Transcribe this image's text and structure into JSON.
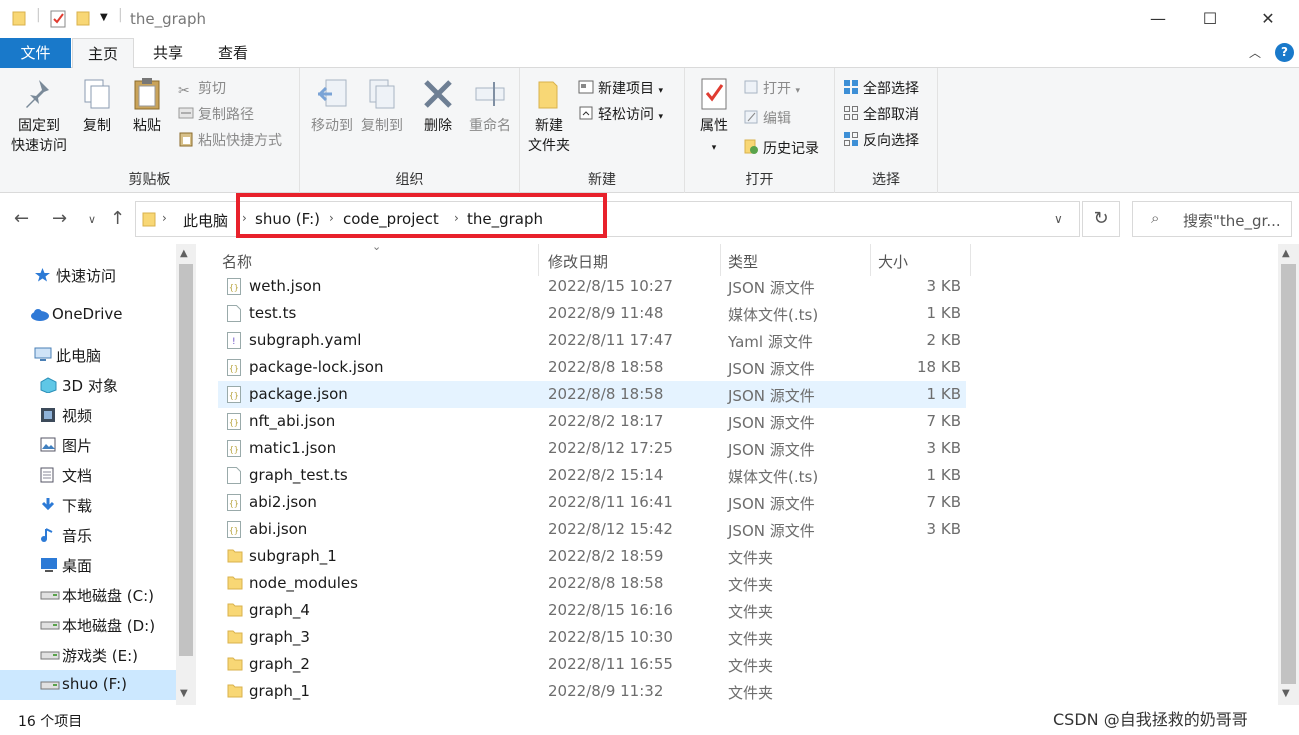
{
  "window": {
    "title": "the_graph",
    "minimize": "—",
    "maximize": "☐",
    "close": "✕"
  },
  "tabs": {
    "file": "文件",
    "home": "主页",
    "share": "共享",
    "view": "查看"
  },
  "ribbon": {
    "clipboard": {
      "label": "剪贴板",
      "pin_line1": "固定到",
      "pin_line2": "快速访问",
      "copy": "复制",
      "paste": "粘贴",
      "cut": "剪切",
      "copy_path": "复制路径",
      "paste_shortcut": "粘贴快捷方式"
    },
    "organize": {
      "label": "组织",
      "move_to": "移动到",
      "copy_to": "复制到",
      "delete": "删除",
      "rename": "重命名"
    },
    "new": {
      "label": "新建",
      "new_folder_line1": "新建",
      "new_folder_line2": "文件夹",
      "new_item": "新建项目",
      "easy_access": "轻松访问"
    },
    "open": {
      "label": "打开",
      "properties": "属性",
      "open": "打开",
      "edit": "编辑",
      "history": "历史记录"
    },
    "select": {
      "label": "选择",
      "select_all": "全部选择",
      "select_none": "全部取消",
      "invert": "反向选择"
    }
  },
  "address": {
    "crumbs": [
      "此电脑",
      "shuo (F:)",
      "code_project",
      "the_graph"
    ],
    "search_placeholder": "搜索\"the_gr..."
  },
  "nav": {
    "items": [
      {
        "label": "快速访问",
        "icon": "star-icon"
      },
      {
        "label": "OneDrive",
        "icon": "cloud-icon"
      },
      {
        "label": "此电脑",
        "icon": "computer-icon"
      },
      {
        "label": "3D 对象",
        "icon": "cube-icon"
      },
      {
        "label": "视频",
        "icon": "film-icon"
      },
      {
        "label": "图片",
        "icon": "picture-icon"
      },
      {
        "label": "文档",
        "icon": "document-icon"
      },
      {
        "label": "下载",
        "icon": "download-icon"
      },
      {
        "label": "音乐",
        "icon": "music-icon"
      },
      {
        "label": "桌面",
        "icon": "desktop-icon"
      },
      {
        "label": "本地磁盘 (C:)",
        "icon": "drive-icon"
      },
      {
        "label": "本地磁盘 (D:)",
        "icon": "drive-icon"
      },
      {
        "label": "游戏类 (E:)",
        "icon": "drive-icon"
      },
      {
        "label": "shuo (F:)",
        "icon": "drive-icon"
      }
    ],
    "selected": "shuo (F:)"
  },
  "columns": {
    "name": "名称",
    "date": "修改日期",
    "type": "类型",
    "size": "大小"
  },
  "files": [
    {
      "name": "weth.json",
      "date": "2022/8/15 10:27",
      "type": "JSON 源文件",
      "size": "3 KB",
      "kind": "json"
    },
    {
      "name": "test.ts",
      "date": "2022/8/9 11:48",
      "type": "媒体文件(.ts)",
      "size": "1 KB",
      "kind": "file"
    },
    {
      "name": "subgraph.yaml",
      "date": "2022/8/11 17:47",
      "type": "Yaml 源文件",
      "size": "2 KB",
      "kind": "yaml"
    },
    {
      "name": "package-lock.json",
      "date": "2022/8/8 18:58",
      "type": "JSON 源文件",
      "size": "18 KB",
      "kind": "json"
    },
    {
      "name": "package.json",
      "date": "2022/8/8 18:58",
      "type": "JSON 源文件",
      "size": "1 KB",
      "kind": "json",
      "selected": true
    },
    {
      "name": "nft_abi.json",
      "date": "2022/8/2 18:17",
      "type": "JSON 源文件",
      "size": "7 KB",
      "kind": "json"
    },
    {
      "name": "matic1.json",
      "date": "2022/8/12 17:25",
      "type": "JSON 源文件",
      "size": "3 KB",
      "kind": "json"
    },
    {
      "name": "graph_test.ts",
      "date": "2022/8/2 15:14",
      "type": "媒体文件(.ts)",
      "size": "1 KB",
      "kind": "file"
    },
    {
      "name": "abi2.json",
      "date": "2022/8/11 16:41",
      "type": "JSON 源文件",
      "size": "7 KB",
      "kind": "json"
    },
    {
      "name": "abi.json",
      "date": "2022/8/12 15:42",
      "type": "JSON 源文件",
      "size": "3 KB",
      "kind": "json"
    },
    {
      "name": "subgraph_1",
      "date": "2022/8/2 18:59",
      "type": "文件夹",
      "size": "",
      "kind": "folder"
    },
    {
      "name": "node_modules",
      "date": "2022/8/8 18:58",
      "type": "文件夹",
      "size": "",
      "kind": "folder"
    },
    {
      "name": "graph_4",
      "date": "2022/8/15 16:16",
      "type": "文件夹",
      "size": "",
      "kind": "folder"
    },
    {
      "name": "graph_3",
      "date": "2022/8/15 10:30",
      "type": "文件夹",
      "size": "",
      "kind": "folder"
    },
    {
      "name": "graph_2",
      "date": "2022/8/11 16:55",
      "type": "文件夹",
      "size": "",
      "kind": "folder"
    },
    {
      "name": "graph_1",
      "date": "2022/8/9 11:32",
      "type": "文件夹",
      "size": "",
      "kind": "folder"
    }
  ],
  "status": {
    "count": "16 个项目"
  },
  "watermark": "CSDN @自我拯救的奶哥哥",
  "colors": {
    "accent": "#1979ca",
    "highlight": "#e8212b",
    "selected_row": "#e5f3ff",
    "folder": "#f8d775"
  }
}
